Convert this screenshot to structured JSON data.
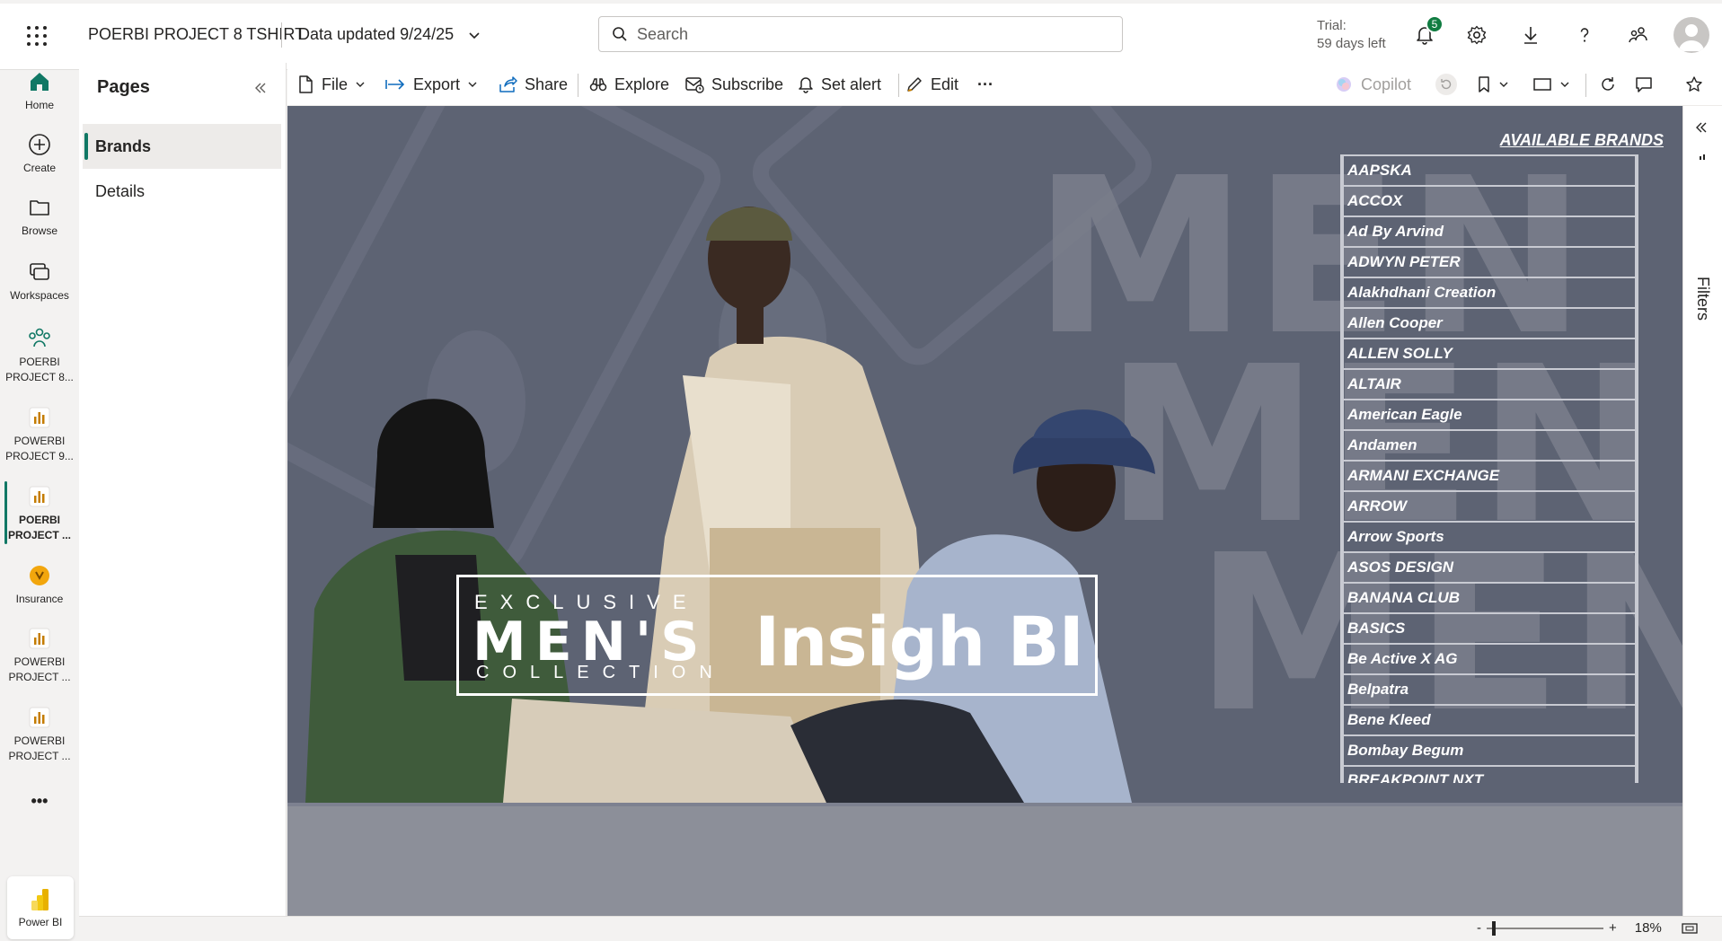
{
  "header": {
    "app_title": "POERBI PROJECT 8 TSHIRT",
    "data_updated": "Data updated 9/24/25",
    "search_placeholder": "Search",
    "trial_line1": "Trial:",
    "trial_line2": "59 days left",
    "notification_count": "5",
    "icons": [
      "waffle-icon",
      "bell-icon",
      "gear-icon",
      "download-icon",
      "help-icon",
      "share-people-icon",
      "avatar"
    ]
  },
  "rail": {
    "items": [
      {
        "label": "Home",
        "icon": "home-icon"
      },
      {
        "label": "Create",
        "icon": "plus-circle-icon"
      },
      {
        "label": "Browse",
        "icon": "folder-icon"
      },
      {
        "label": "Workspaces",
        "icon": "workspaces-icon"
      },
      {
        "label": "POERBI PROJECT 8...",
        "icon": "workspace-people-icon"
      },
      {
        "label": "POWERBI PROJECT 9...",
        "icon": "report-icon"
      },
      {
        "label": "POERBI PROJECT ...",
        "icon": "report-icon"
      },
      {
        "label": "Insurance",
        "icon": "insurance-icon"
      },
      {
        "label": "POWERBI PROJECT ...",
        "icon": "report-icon"
      },
      {
        "label": "POWERBI PROJECT ...",
        "icon": "report-icon"
      }
    ],
    "more": "•••",
    "product": "Power BI"
  },
  "pages": {
    "title": "Pages",
    "items": [
      "Brands",
      "Details"
    ]
  },
  "toolbar": {
    "file": "File",
    "export": "Export",
    "share": "Share",
    "explore": "Explore",
    "subscribe": "Subscribe",
    "set_alert": "Set alert",
    "edit": "Edit",
    "more": "···",
    "copilot": "Copilot"
  },
  "report": {
    "bg_word": "MEN",
    "hero_line1": "EXCLUSIVE",
    "hero_line2": "MEN'S",
    "hero_line3": "COLLECTION",
    "hero_title": "Insigh BI",
    "brands_title": "AVAILABLE BRANDS",
    "brands": [
      "AAPSKA",
      "ACCOX",
      "Ad By Arvind",
      "ADWYN PETER",
      "Alakhdhani Creation",
      "Allen Cooper",
      "ALLEN SOLLY",
      "ALTAIR",
      "American Eagle",
      "Andamen",
      "ARMANI EXCHANGE",
      "ARROW",
      "Arrow Sports",
      "ASOS DESIGN",
      "BANANA CLUB",
      "BASICS",
      "Be Active X AG",
      "Belpatra",
      "Bene Kleed",
      "Bombay Begum",
      "BREAKPOINT NXT"
    ]
  },
  "filters": {
    "label": "Filters"
  },
  "status": {
    "zoom_minus": "-",
    "zoom_plus": "+",
    "zoom_level": "18%"
  },
  "colors": {
    "accent": "#117865",
    "badge": "#107c41",
    "report_bg": "#5d6373"
  }
}
